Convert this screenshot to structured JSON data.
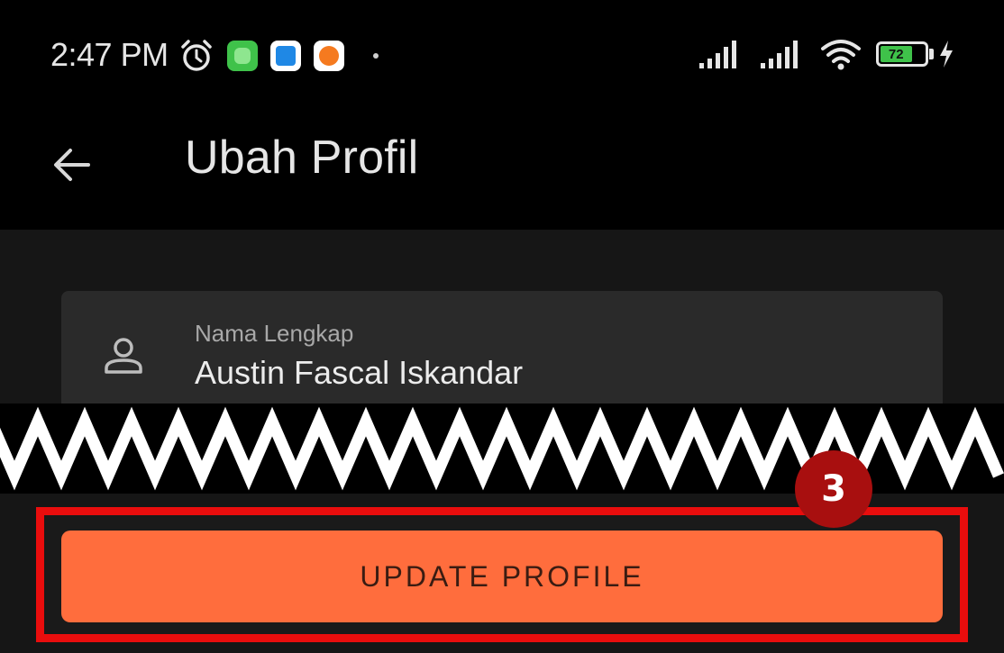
{
  "status_bar": {
    "time": "2:47 PM",
    "battery_level": "72",
    "icons": [
      "alarm-icon",
      "app-green-icon",
      "app-blue-icon",
      "app-orange-icon",
      "signal-icon",
      "signal-icon",
      "wifi-icon",
      "battery-icon",
      "charging-bolt-icon"
    ]
  },
  "app_bar": {
    "title": "Ubah Profil",
    "back_icon": "arrow-left-icon"
  },
  "form": {
    "name_field": {
      "label": "Nama Lengkap",
      "value": "Austin Fascal Iskandar",
      "icon": "person-icon"
    }
  },
  "actions": {
    "update_label": "UPDATE PROFILE"
  },
  "annotation": {
    "step_number": "3",
    "highlight_color": "#e90d0d",
    "badge_color": "#a80f0f"
  },
  "colors": {
    "accent": "#ff6d3d",
    "background": "#161616",
    "field_background": "#2a2a2a"
  }
}
